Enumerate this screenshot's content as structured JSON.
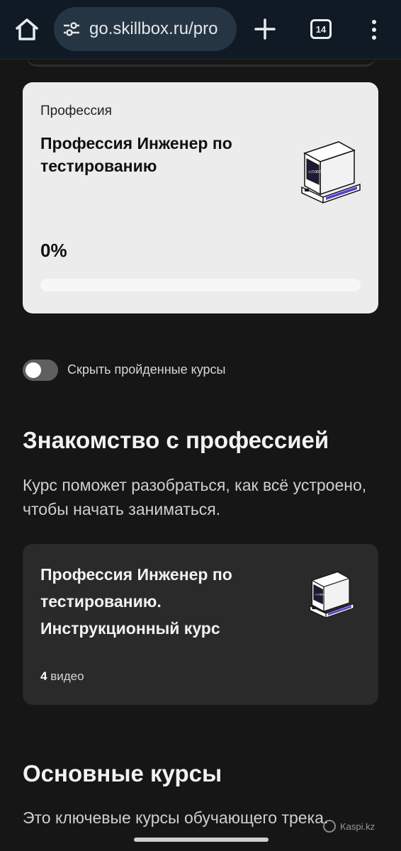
{
  "browser": {
    "url": "go.skillbox.ru/pro",
    "tab_count": "14"
  },
  "profession_card": {
    "kicker": "Профессия",
    "title": "Профессия Инженер по тестированию",
    "progress_text": "0%",
    "progress_value": 0
  },
  "toggle": {
    "label": "Скрыть пройденные курсы",
    "checked": false
  },
  "intro_section": {
    "title": "Знакомство с профессией",
    "description": "Курс поможет разобраться, как всё устроено, чтобы начать заниматься."
  },
  "intro_course": {
    "title": "Профессия Инженер по тестированию. Инструкционный курс",
    "video_count": "4",
    "video_label": "видео"
  },
  "main_section": {
    "title": "Основные курсы",
    "description": "Это ключевые курсы обучающего трека."
  },
  "watermark": "Kaspi.kz",
  "colors": {
    "background": "#161616",
    "browser_bar": "#0f1a24",
    "url_pill": "#263543",
    "card_light": "#ececec",
    "card_dark": "#2a2a2a",
    "accent": "#7c5cff"
  },
  "icons": {
    "home": "home-icon",
    "site_settings": "tune-icon",
    "new_tab": "plus-icon",
    "tabs": "tab-count-icon",
    "menu": "more-vert-icon",
    "illustration": "code-computer-illustration"
  }
}
